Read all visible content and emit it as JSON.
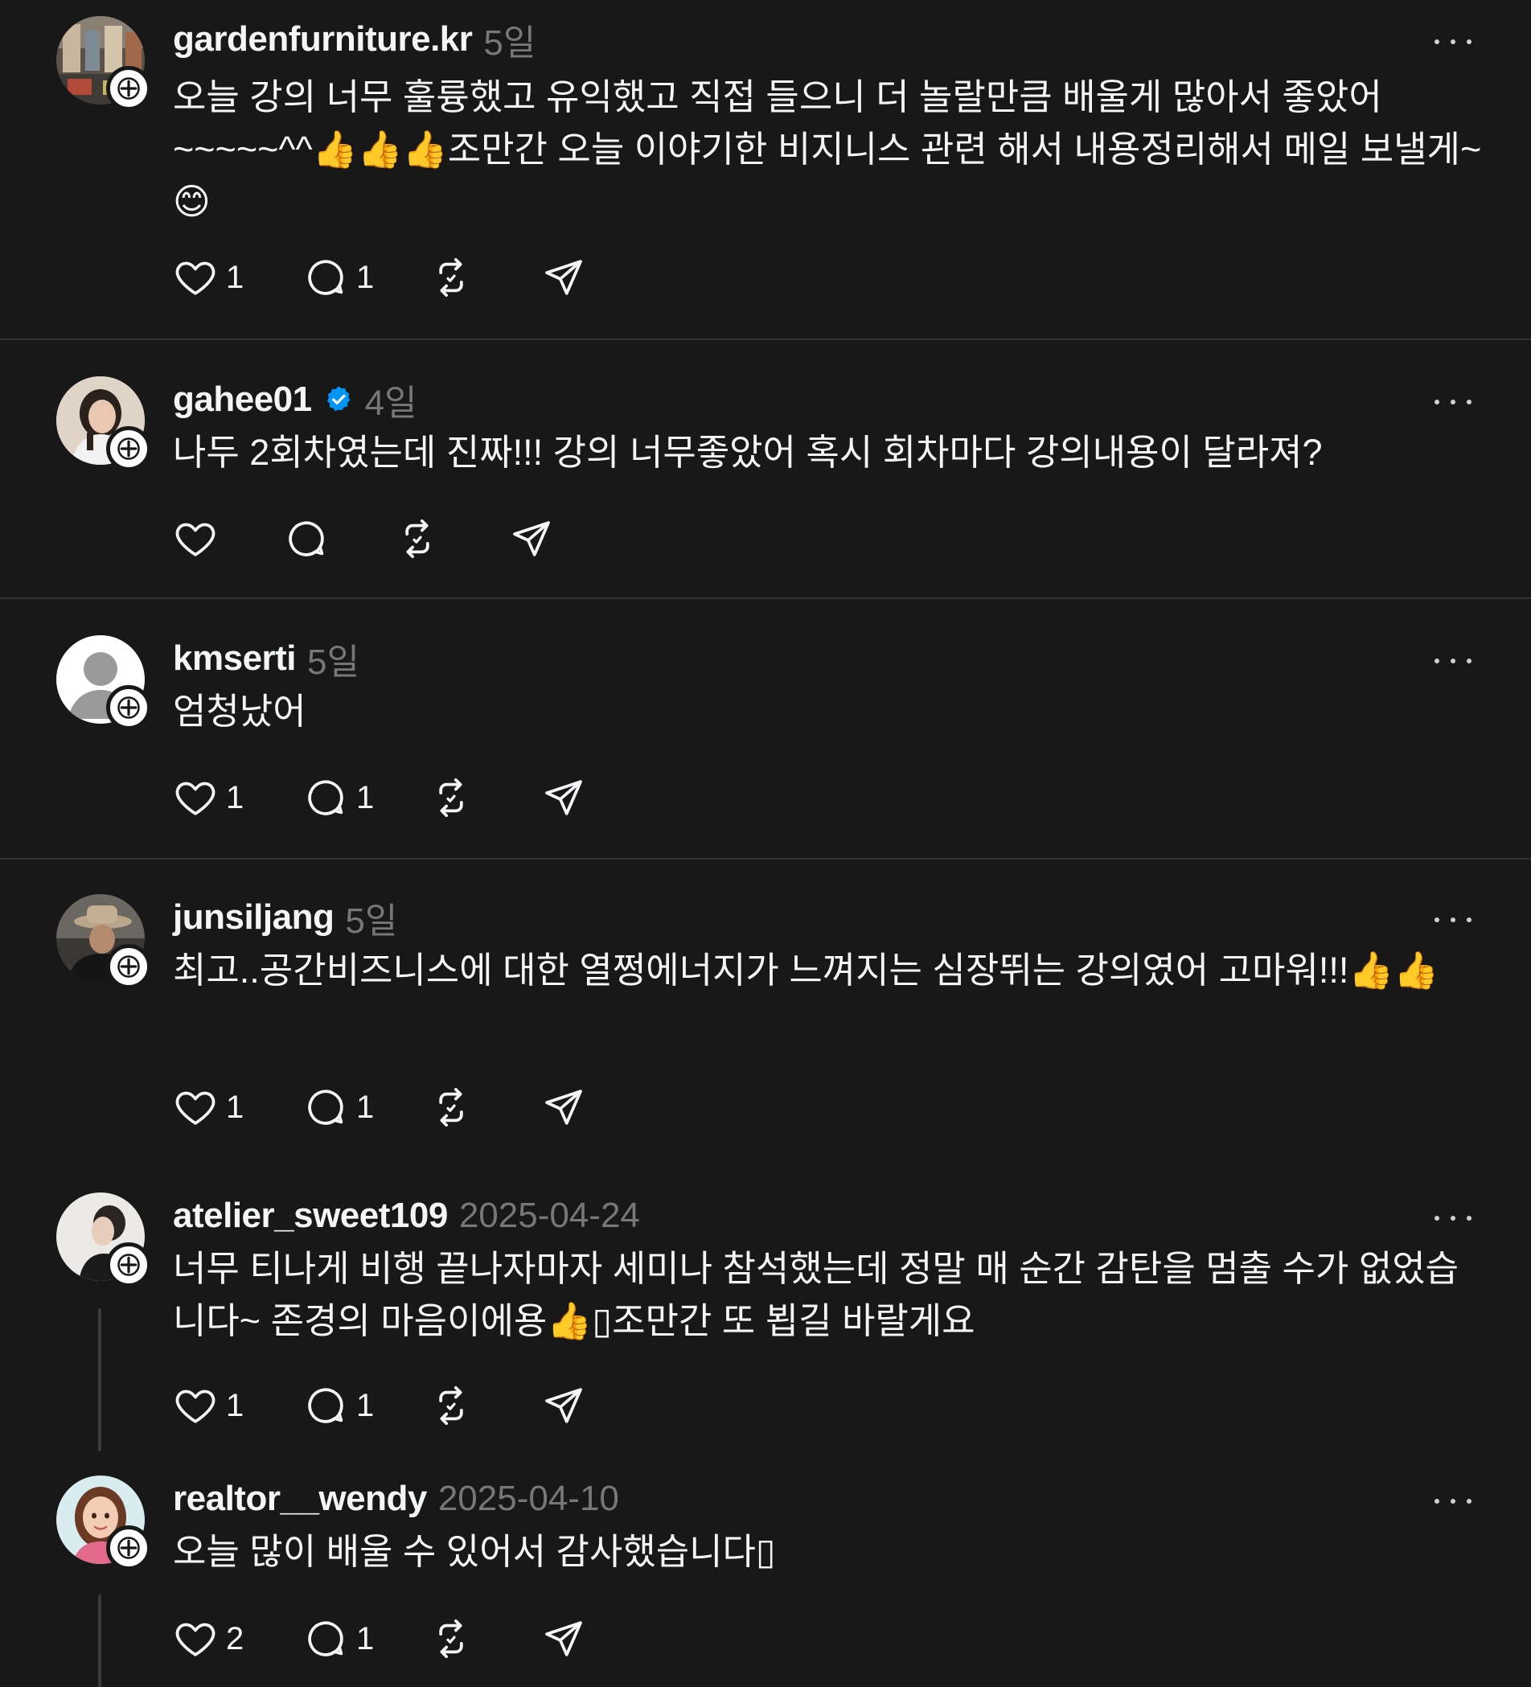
{
  "posts": [
    {
      "username": "gardenfurniture.kr",
      "timestamp": "5일",
      "verified": false,
      "text": "오늘 강의 너무 훌륭했고 유익했고 직접 들으니 더 놀랄만큼 배울게 많아서 좋았어~~~~~^^👍👍👍조만간 오늘 이야기한 비지니스 관련 해서 내용정리해서 메일 보낼게~ 😊",
      "likes": "1",
      "replies": "1",
      "avatar": "shop-photo"
    },
    {
      "username": "gahee01",
      "timestamp": "4일",
      "verified": true,
      "text": "나두 2회차였는데 진짜!!! 강의 너무좋았어 혹시 회차마다 강의내용이 달라져?",
      "likes": "",
      "replies": "",
      "avatar": "woman-portrait"
    },
    {
      "username": "kmserti",
      "timestamp": "5일",
      "verified": false,
      "text": "엄청났어",
      "likes": "1",
      "replies": "1",
      "avatar": "default-avatar"
    },
    {
      "username": "junsiljang",
      "timestamp": "5일",
      "verified": false,
      "text": "최고..공간비즈니스에 대한 열쩡에너지가 느껴지는 심장뛰는 강의였어 고마워!!!👍👍",
      "likes": "1",
      "replies": "1",
      "avatar": "man-hat"
    },
    {
      "username": "atelier_sweet109",
      "timestamp": "2025-04-24",
      "verified": false,
      "text": "너무 티나게 비행 끝나자마자 세미나 참석했는데 정말 매 순간 감탄을 멈출 수가 없었습니다~ 존경의 마음이에용👍▯조만간 또 뵙길 바랄게요",
      "likes": "1",
      "replies": "1",
      "avatar": "woman-profile"
    },
    {
      "username": "realtor__wendy",
      "timestamp": "2025-04-10",
      "verified": false,
      "text": "오늘 많이 배울 수 있어서 감사했습니다▯",
      "likes": "2",
      "replies": "1",
      "avatar": "illustrated-woman"
    }
  ],
  "icons": {
    "like": "heart-icon",
    "reply": "comment-icon",
    "repost": "repost-icon",
    "share": "send-icon",
    "more": "more-icon",
    "follow": "plus-icon",
    "verified": "verified-badge-icon"
  },
  "colors": {
    "background": "#181818",
    "text": "#f3f5f7",
    "muted": "#777777",
    "divider": "#323232",
    "verified": "#0095f6"
  }
}
